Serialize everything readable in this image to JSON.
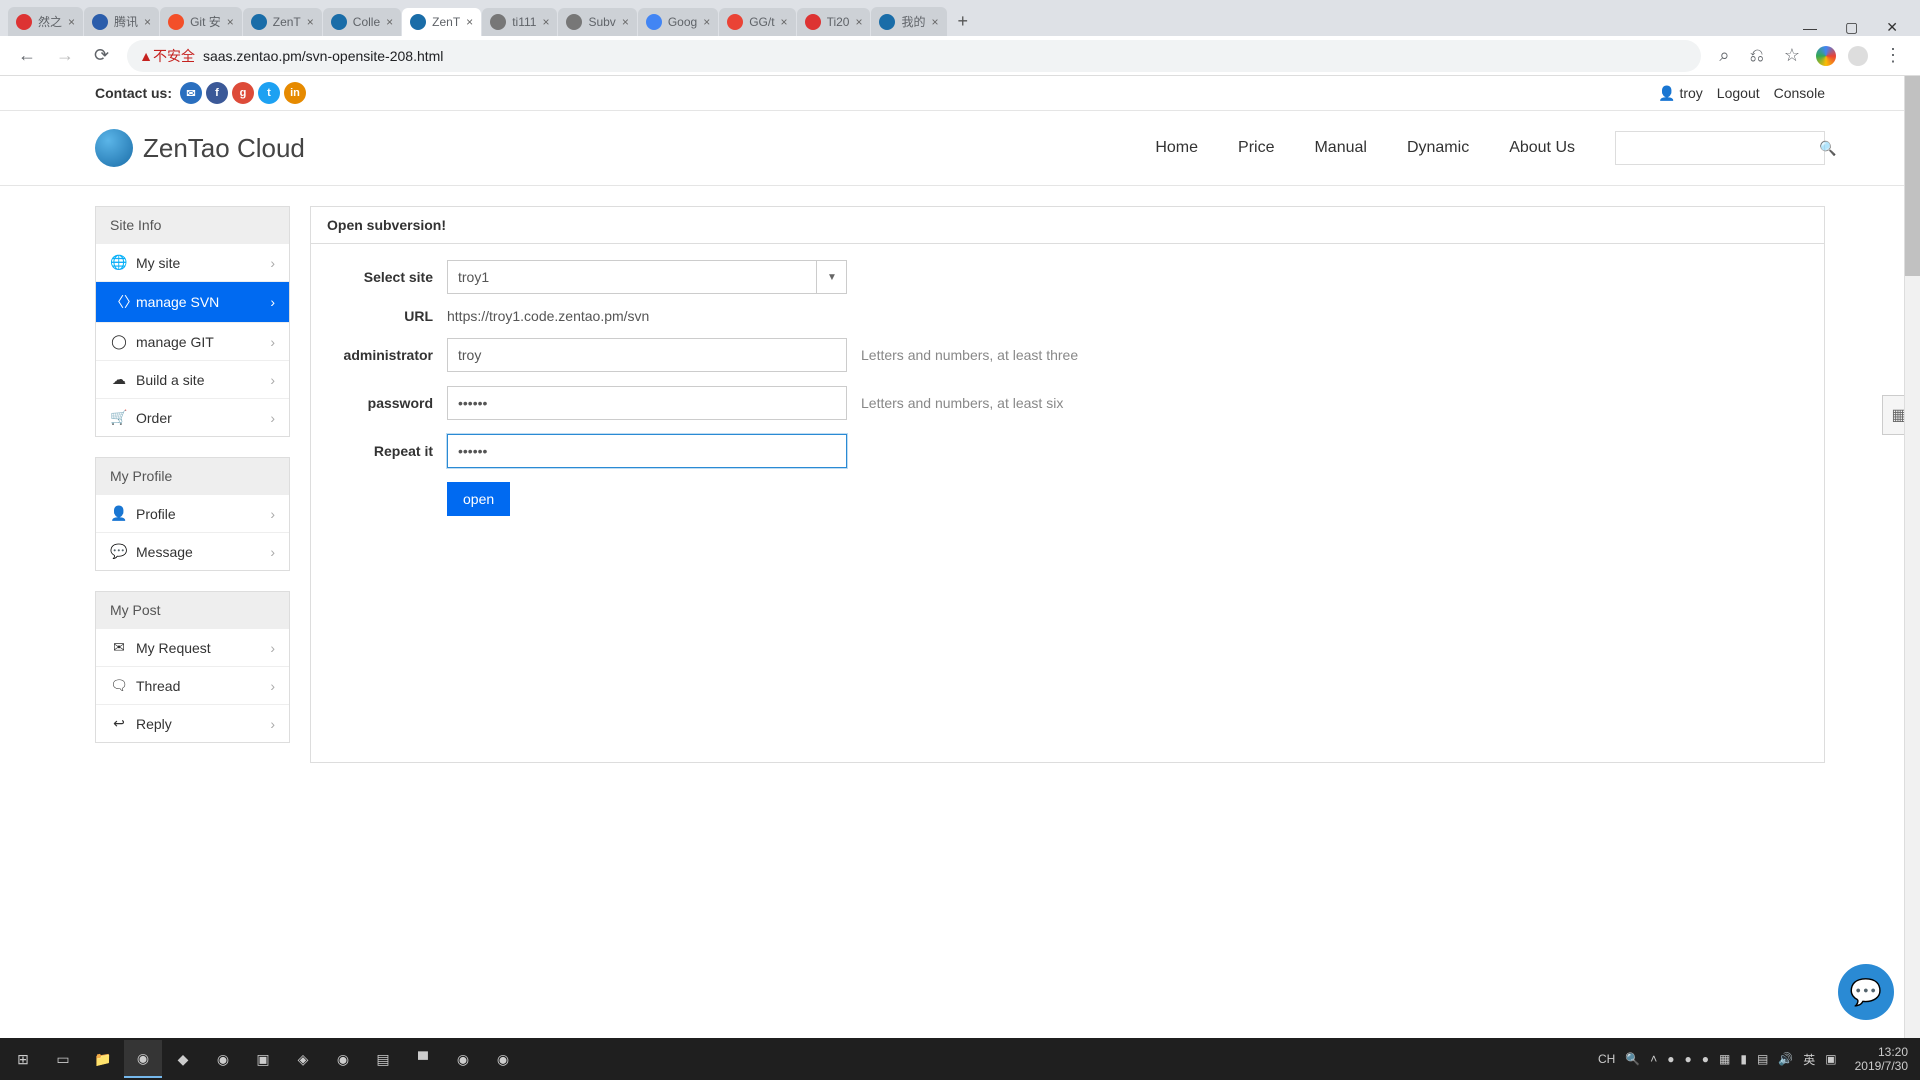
{
  "browser": {
    "tabs": [
      {
        "title": "然之"
      },
      {
        "title": "腾讯"
      },
      {
        "title": "Git 安"
      },
      {
        "title": "ZenT"
      },
      {
        "title": "Colle"
      },
      {
        "title": "ZenT",
        "active": true
      },
      {
        "title": "ti111"
      },
      {
        "title": "Subv"
      },
      {
        "title": "Goog"
      },
      {
        "title": "GG/t"
      },
      {
        "title": "Ti20"
      },
      {
        "title": "我的"
      }
    ],
    "not_secure": "不安全",
    "url": "saas.zentao.pm/svn-opensite-208.html"
  },
  "topbar": {
    "contact_label": "Contact us:",
    "username": "troy",
    "logout": "Logout",
    "console": "Console"
  },
  "brand": "ZenTao Cloud",
  "nav": {
    "home": "Home",
    "price": "Price",
    "manual": "Manual",
    "dynamic": "Dynamic",
    "about": "About Us"
  },
  "sidebar": {
    "site_info": {
      "head": "Site Info",
      "my_site": "My site",
      "manage_svn": "manage SVN",
      "manage_git": "manage GIT",
      "build_site": "Build a site",
      "order": "Order"
    },
    "my_profile": {
      "head": "My Profile",
      "profile": "Profile",
      "message": "Message"
    },
    "my_post": {
      "head": "My Post",
      "my_request": "My Request",
      "thread": "Thread",
      "reply": "Reply"
    }
  },
  "panel": {
    "title": "Open subversion!"
  },
  "form": {
    "select_site_label": "Select site",
    "select_site_value": "troy1",
    "url_label": "URL",
    "url_value": "https://troy1.code.zentao.pm/svn",
    "admin_label": "administrator",
    "admin_value": "troy",
    "admin_hint": "Letters and numbers, at least three",
    "password_label": "password",
    "password_value": "••••••",
    "password_hint": "Letters and numbers, at least six",
    "repeat_label": "Repeat it",
    "repeat_value": "••••••",
    "submit": "open"
  },
  "taskbar": {
    "ime": "CH",
    "lang": "英",
    "time": "13:20",
    "date": "2019/7/30"
  }
}
